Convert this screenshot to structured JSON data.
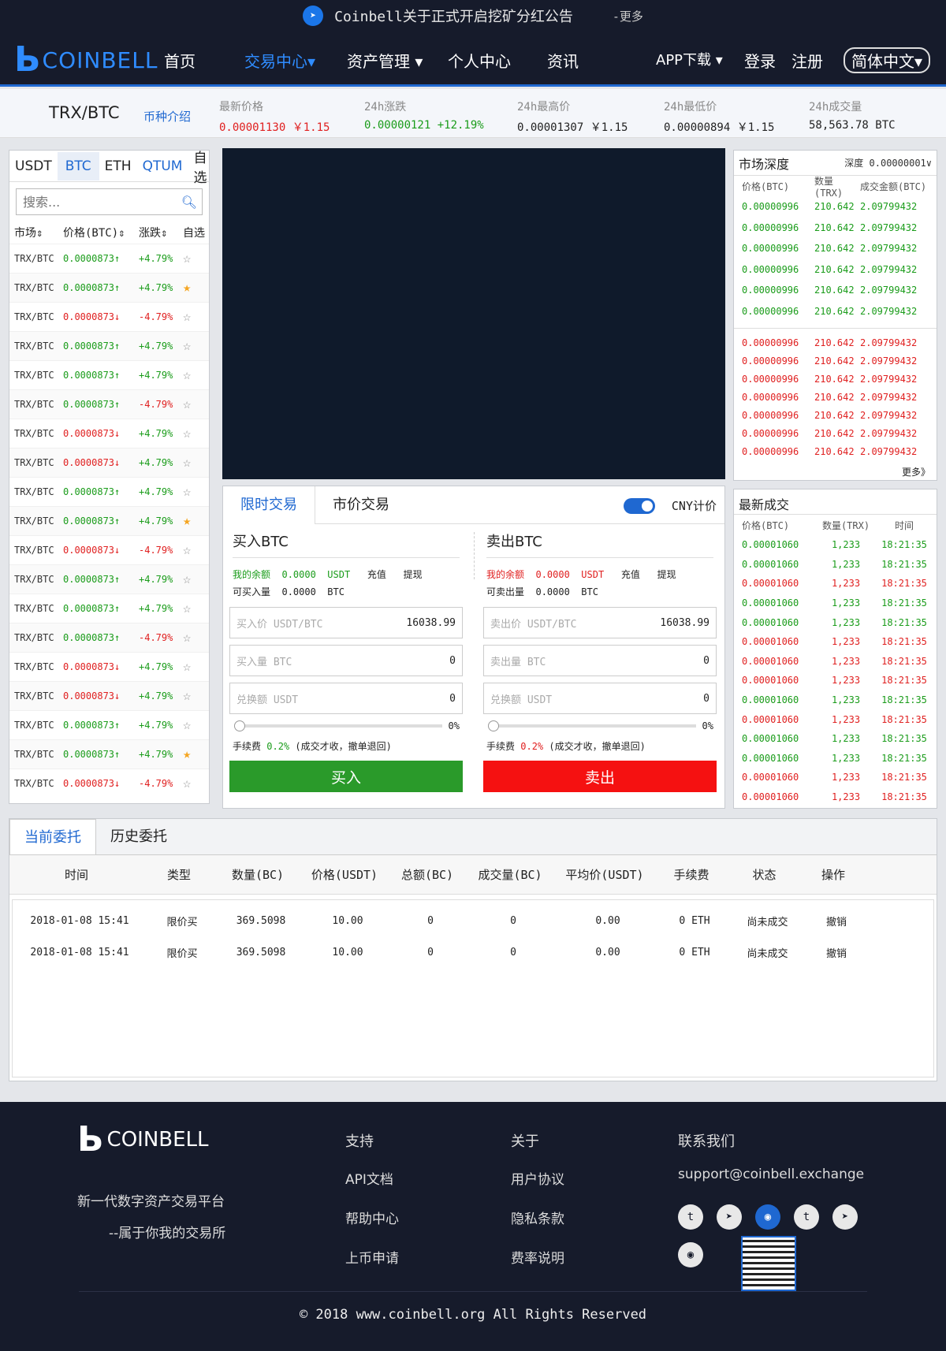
{
  "notice": {
    "text": "Coinbell关于正式开启挖矿分红公告",
    "more": "-更多"
  },
  "nav": {
    "logo": "COINBELL",
    "items": [
      "首页",
      "交易中心▾",
      "资产管理 ▾",
      "个人中心",
      "资讯"
    ],
    "right": [
      "APP下载 ▾",
      "登录",
      "注册"
    ],
    "lang": "简体中文▾"
  },
  "ticker": {
    "pair": "TRX/BTC",
    "intro": "币种介绍",
    "stats": [
      {
        "label": "最新价格",
        "value": "0.00001130 ￥1.15"
      },
      {
        "label": "24h涨跌",
        "value": "0.00000121 +12.19%"
      },
      {
        "label": "24h最高价",
        "value": "0.00001307 ￥1.15"
      },
      {
        "label": "24h最低价",
        "value": "0.00000894 ￥1.15"
      },
      {
        "label": "24h成交量",
        "value": "58,563.78 BTC"
      }
    ]
  },
  "market": {
    "tabs": [
      "USDT",
      "BTC",
      "ETH",
      "QTUM",
      "自选"
    ],
    "search_placeholder": "搜索...",
    "headers": [
      "市场⇕",
      "价格(BTC)⇕",
      "涨跌⇕",
      "自选"
    ],
    "rows": [
      {
        "m": "TRX/BTC",
        "p": "0.0000873↑",
        "c": "+4.79%",
        "pd": "up",
        "cd": "up",
        "fav": false
      },
      {
        "m": "TRX/BTC",
        "p": "0.0000873↑",
        "c": "+4.79%",
        "pd": "up",
        "cd": "up",
        "fav": true
      },
      {
        "m": "TRX/BTC",
        "p": "0.0000873↓",
        "c": "-4.79%",
        "pd": "down",
        "cd": "down",
        "fav": false
      },
      {
        "m": "TRX/BTC",
        "p": "0.0000873↑",
        "c": "+4.79%",
        "pd": "up",
        "cd": "up",
        "fav": false
      },
      {
        "m": "TRX/BTC",
        "p": "0.0000873↑",
        "c": "+4.79%",
        "pd": "up",
        "cd": "up",
        "fav": false
      },
      {
        "m": "TRX/BTC",
        "p": "0.0000873↑",
        "c": "-4.79%",
        "pd": "up",
        "cd": "down",
        "fav": false
      },
      {
        "m": "TRX/BTC",
        "p": "0.0000873↓",
        "c": "+4.79%",
        "pd": "down",
        "cd": "up",
        "fav": false
      },
      {
        "m": "TRX/BTC",
        "p": "0.0000873↓",
        "c": "+4.79%",
        "pd": "down",
        "cd": "up",
        "fav": false
      },
      {
        "m": "TRX/BTC",
        "p": "0.0000873↑",
        "c": "+4.79%",
        "pd": "up",
        "cd": "up",
        "fav": false
      },
      {
        "m": "TRX/BTC",
        "p": "0.0000873↑",
        "c": "+4.79%",
        "pd": "up",
        "cd": "up",
        "fav": true
      },
      {
        "m": "TRX/BTC",
        "p": "0.0000873↓",
        "c": "-4.79%",
        "pd": "down",
        "cd": "down",
        "fav": false
      },
      {
        "m": "TRX/BTC",
        "p": "0.0000873↑",
        "c": "+4.79%",
        "pd": "up",
        "cd": "up",
        "fav": false
      },
      {
        "m": "TRX/BTC",
        "p": "0.0000873↑",
        "c": "+4.79%",
        "pd": "up",
        "cd": "up",
        "fav": false
      },
      {
        "m": "TRX/BTC",
        "p": "0.0000873↑",
        "c": "-4.79%",
        "pd": "up",
        "cd": "down",
        "fav": false
      },
      {
        "m": "TRX/BTC",
        "p": "0.0000873↓",
        "c": "+4.79%",
        "pd": "down",
        "cd": "up",
        "fav": false
      },
      {
        "m": "TRX/BTC",
        "p": "0.0000873↓",
        "c": "+4.79%",
        "pd": "down",
        "cd": "up",
        "fav": false
      },
      {
        "m": "TRX/BTC",
        "p": "0.0000873↑",
        "c": "+4.79%",
        "pd": "up",
        "cd": "up",
        "fav": false
      },
      {
        "m": "TRX/BTC",
        "p": "0.0000873↑",
        "c": "+4.79%",
        "pd": "up",
        "cd": "up",
        "fav": true
      },
      {
        "m": "TRX/BTC",
        "p": "0.0000873↓",
        "c": "-4.79%",
        "pd": "down",
        "cd": "down",
        "fav": false
      }
    ]
  },
  "depth": {
    "title": "市场深度",
    "depth_label": "深度 0.00000001∨",
    "headers": [
      "价格(BTC)",
      "数量(TRX)",
      "成交金额(BTC)"
    ],
    "buy": [
      [
        "0.00000996",
        "210.642",
        "2.09799432"
      ],
      [
        "0.00000996",
        "210.642",
        "2.09799432"
      ],
      [
        "0.00000996",
        "210.642",
        "2.09799432"
      ],
      [
        "0.00000996",
        "210.642",
        "2.09799432"
      ],
      [
        "0.00000996",
        "210.642",
        "2.09799432"
      ],
      [
        "0.00000996",
        "210.642",
        "2.09799432"
      ]
    ],
    "sell": [
      [
        "0.00000996",
        "210.642",
        "2.09799432"
      ],
      [
        "0.00000996",
        "210.642",
        "2.09799432"
      ],
      [
        "0.00000996",
        "210.642",
        "2.09799432"
      ],
      [
        "0.00000996",
        "210.642",
        "2.09799432"
      ],
      [
        "0.00000996",
        "210.642",
        "2.09799432"
      ],
      [
        "0.00000996",
        "210.642",
        "2.09799432"
      ],
      [
        "0.00000996",
        "210.642",
        "2.09799432"
      ]
    ],
    "more": "更多》"
  },
  "trades": {
    "title": "最新成交",
    "headers": [
      "价格(BTC)",
      "数量(TRX)",
      "时间"
    ],
    "rows": [
      [
        "0.00001060",
        "1,233",
        "18:21:35",
        "up"
      ],
      [
        "0.00001060",
        "1,233",
        "18:21:35",
        "up"
      ],
      [
        "0.00001060",
        "1,233",
        "18:21:35",
        "down"
      ],
      [
        "0.00001060",
        "1,233",
        "18:21:35",
        "up"
      ],
      [
        "0.00001060",
        "1,233",
        "18:21:35",
        "up"
      ],
      [
        "0.00001060",
        "1,233",
        "18:21:35",
        "down"
      ],
      [
        "0.00001060",
        "1,233",
        "18:21:35",
        "down"
      ],
      [
        "0.00001060",
        "1,233",
        "18:21:35",
        "down"
      ],
      [
        "0.00001060",
        "1,233",
        "18:21:35",
        "up"
      ],
      [
        "0.00001060",
        "1,233",
        "18:21:35",
        "down"
      ],
      [
        "0.00001060",
        "1,233",
        "18:21:35",
        "up"
      ],
      [
        "0.00001060",
        "1,233",
        "18:21:35",
        "up"
      ],
      [
        "0.00001060",
        "1,233",
        "18:21:35",
        "down"
      ],
      [
        "0.00001060",
        "1,233",
        "18:21:35",
        "down"
      ]
    ]
  },
  "form": {
    "tabs": [
      "限时交易",
      "市价交易"
    ],
    "cny": "CNY计价",
    "buy": {
      "title": "买入BTC",
      "bal_label": "我的余额",
      "bal": "0.0000",
      "bal_unit": "USDT",
      "deposit": "充值",
      "withdraw": "提现",
      "avail_label": "可买入量",
      "avail": "0.0000",
      "avail_unit": "BTC",
      "price_label": "买入价 USDT/BTC",
      "price": "16038.99",
      "amount_label": "买入量 BTC",
      "amount": "0",
      "total_label": "兑换额 USDT",
      "total": "0",
      "pct": "0%",
      "fee_label": "手续费",
      "fee": "0.2%",
      "fee_note": "(成交才收，撤单退回)",
      "button": "买入"
    },
    "sell": {
      "title": "卖出BTC",
      "bal_label": "我的余额",
      "bal": "0.0000",
      "bal_unit": "USDT",
      "deposit": "充值",
      "withdraw": "提现",
      "avail_label": "可卖出量",
      "avail": "0.0000",
      "avail_unit": "BTC",
      "price_label": "卖出价 USDT/BTC",
      "price": "16038.99",
      "amount_label": "卖出量 BTC",
      "amount": "0",
      "total_label": "兑换额 USDT",
      "total": "0",
      "pct": "0%",
      "fee_label": "手续费",
      "fee": "0.2%",
      "fee_note": "(成交才收，撤单退回)",
      "button": "卖出"
    }
  },
  "orders": {
    "tabs": [
      "当前委托",
      "历史委托"
    ],
    "headers": [
      "时间",
      "类型",
      "数量(BC)",
      "价格(USDT)",
      "总额(BC)",
      "成交量(BC)",
      "平均价(USDT)",
      "手续费",
      "状态",
      "操作"
    ],
    "rows": [
      [
        "2018-01-08 15:41",
        "限价买",
        "369.5098",
        "10.00",
        "0",
        "0",
        "0.00",
        "0 ETH",
        "尚未成交",
        "撤销"
      ],
      [
        "2018-01-08 15:41",
        "限价买",
        "369.5098",
        "10.00",
        "0",
        "0",
        "0.00",
        "0 ETH",
        "尚未成交",
        "撤销"
      ]
    ]
  },
  "footer": {
    "logo": "COINBELL",
    "slogan1": "新一代数字资产交易平台",
    "slogan2": "--属于你我的交易所",
    "col1": {
      "title": "支持",
      "links": [
        "API文档",
        "帮助中心",
        "上币申请"
      ]
    },
    "col2": {
      "title": "关于",
      "links": [
        "用户协议",
        "隐私条款",
        "费率说明"
      ]
    },
    "col3": {
      "title": "联系我们",
      "email": "support@coinbell.exchange"
    },
    "copyright": "© 2018 www.coinbell.org All Rights Reserved"
  }
}
